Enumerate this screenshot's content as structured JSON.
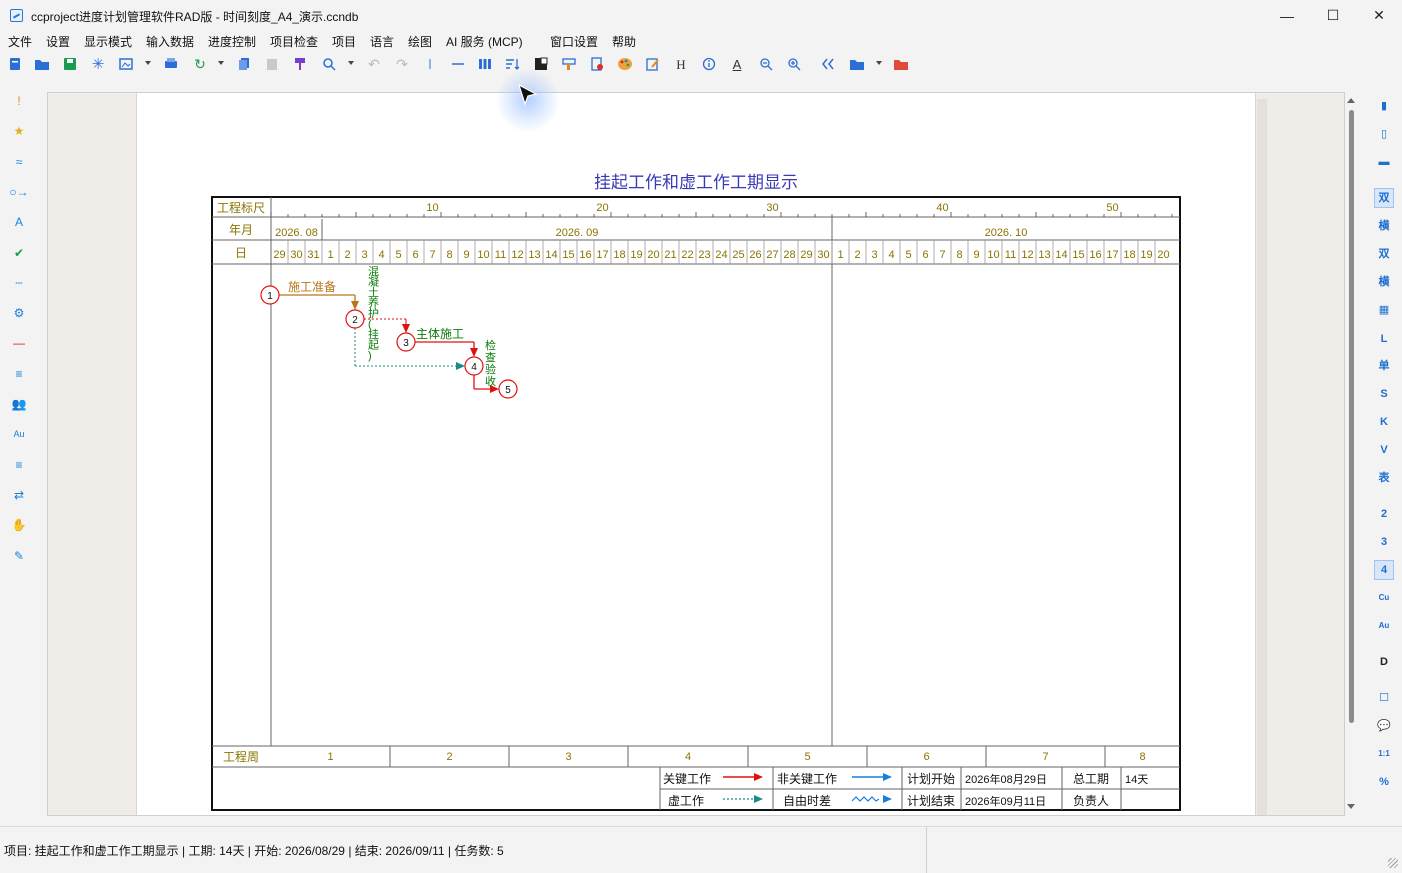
{
  "window": {
    "title": "ccproject进度计划管理软件RAD版 - 时间刻度_A4_演示.ccndb",
    "min_glyph": "—",
    "max_glyph": "☐",
    "close_glyph": "✕"
  },
  "menu": [
    "文件",
    "设置",
    "显示模式",
    "输入数据",
    "进度控制",
    "项目检查",
    "项目",
    "语言",
    "绘图",
    "AI 服务 (MCP)",
    "窗口设置",
    "帮助"
  ],
  "toolbar_icons": [
    "new-file-icon",
    "open-folder-icon",
    "save-icon",
    "snowflake-icon",
    "export-image-icon",
    "print-icon",
    "refresh-icon",
    "copy-icon",
    "paste-icon",
    "format-painter-icon",
    "zoom-icon",
    "undo-icon",
    "redo-icon",
    "separator-icon",
    "line-icon",
    "columns-icon",
    "sort-icon",
    "contrast-icon",
    "highlighter-icon",
    "page-settings-icon",
    "palette-icon",
    "edit-note-icon",
    "heading-icon",
    "info-icon",
    "text-color-icon",
    "zoom-out-icon",
    "zoom-in-icon",
    "collapse-icon",
    "open-project-icon",
    "red-folder-icon"
  ],
  "toolbar_glyphs": {
    "heading": "H",
    "text": "A"
  },
  "left_tools": [
    "!",
    "★",
    "≈",
    "○→",
    "A",
    "✔",
    "┄",
    "⚙",
    "—",
    "≡",
    "👥",
    "Au",
    "≡",
    "⇄",
    "✋",
    "✎"
  ],
  "right_tools": [
    {
      "label": "▮",
      "active": false
    },
    {
      "label": "▯",
      "active": false
    },
    {
      "label": "▬",
      "active": false
    },
    {
      "label": "双",
      "active": true
    },
    {
      "label": "横",
      "active": false
    },
    {
      "label": "双",
      "active": false
    },
    {
      "label": "横",
      "active": false
    },
    {
      "label": "▦",
      "active": false
    },
    {
      "label": "L",
      "active": false
    },
    {
      "label": "单",
      "active": false
    },
    {
      "label": "S",
      "active": false
    },
    {
      "label": "K",
      "active": false
    },
    {
      "label": "V",
      "active": false
    },
    {
      "label": "表",
      "active": false
    },
    {
      "label": "2",
      "active": false
    },
    {
      "label": "3",
      "active": false
    },
    {
      "label": "4",
      "active": true
    },
    {
      "label": "Cu",
      "active": false
    },
    {
      "label": "Au",
      "active": false
    },
    {
      "label": "D",
      "active": false
    },
    {
      "label": "☐",
      "active": false
    },
    {
      "label": "💬",
      "active": false
    },
    {
      "label": "1:1",
      "active": false
    },
    {
      "label": "%",
      "active": false
    }
  ],
  "chart": {
    "title": "挂起工作和虚工作工期显示",
    "row_labels": {
      "ruler": "工程标尺",
      "month": "年月",
      "day": "日",
      "week": "工程周"
    },
    "ruler_ticks": [
      "10",
      "20",
      "30",
      "40",
      "50"
    ],
    "months": [
      "2026. 08",
      "2026. 09",
      "2026. 10"
    ],
    "days": [
      "29",
      "30",
      "31",
      "1",
      "2",
      "3",
      "4",
      "5",
      "6",
      "7",
      "8",
      "9",
      "10",
      "11",
      "12",
      "13",
      "14",
      "15",
      "16",
      "17",
      "18",
      "19",
      "20",
      "21",
      "22",
      "23",
      "24",
      "25",
      "26",
      "27",
      "28",
      "29",
      "30",
      "1",
      "2",
      "3",
      "4",
      "5",
      "6",
      "7",
      "8",
      "9",
      "10",
      "11",
      "12",
      "13",
      "14",
      "15",
      "16",
      "17",
      "18",
      "19",
      "20"
    ],
    "weeks": [
      "1",
      "2",
      "3",
      "4",
      "5",
      "6",
      "7",
      "8"
    ],
    "nodes": [
      "1",
      "2",
      "3",
      "4",
      "5"
    ],
    "tasks": {
      "prep": "施工准备",
      "curing": [
        "混",
        "凝",
        "土",
        "养",
        "护",
        "(",
        "挂",
        "起",
        ")"
      ],
      "main": "主体施工",
      "inspect": [
        "检",
        "查",
        "验",
        "收"
      ]
    },
    "legend": {
      "critical": "关键工作",
      "noncritical": "非关键工作",
      "dummy": "虚工作",
      "float": "自由时差",
      "plan_start_label": "计划开始",
      "plan_start": "2026年08月29日",
      "plan_end_label": "计划结束",
      "plan_end": "2026年09月11日",
      "duration_label": "总工期",
      "duration": "14天",
      "owner_label": "负责人",
      "owner": ""
    },
    "colors": {
      "critical": "#e01010",
      "noncritical": "#1a7fd8",
      "dummy": "#1a8a8a",
      "prep": "#b8761a",
      "label_green": "#0a7a0a",
      "title": "#3a3ab8",
      "scale_text": "#8a7400"
    }
  },
  "status": "项目: 挂起工作和虚工作工期显示 | 工期: 14天 | 开始: 2026/08/29 | 结束: 2026/09/11 | 任务数: 5"
}
